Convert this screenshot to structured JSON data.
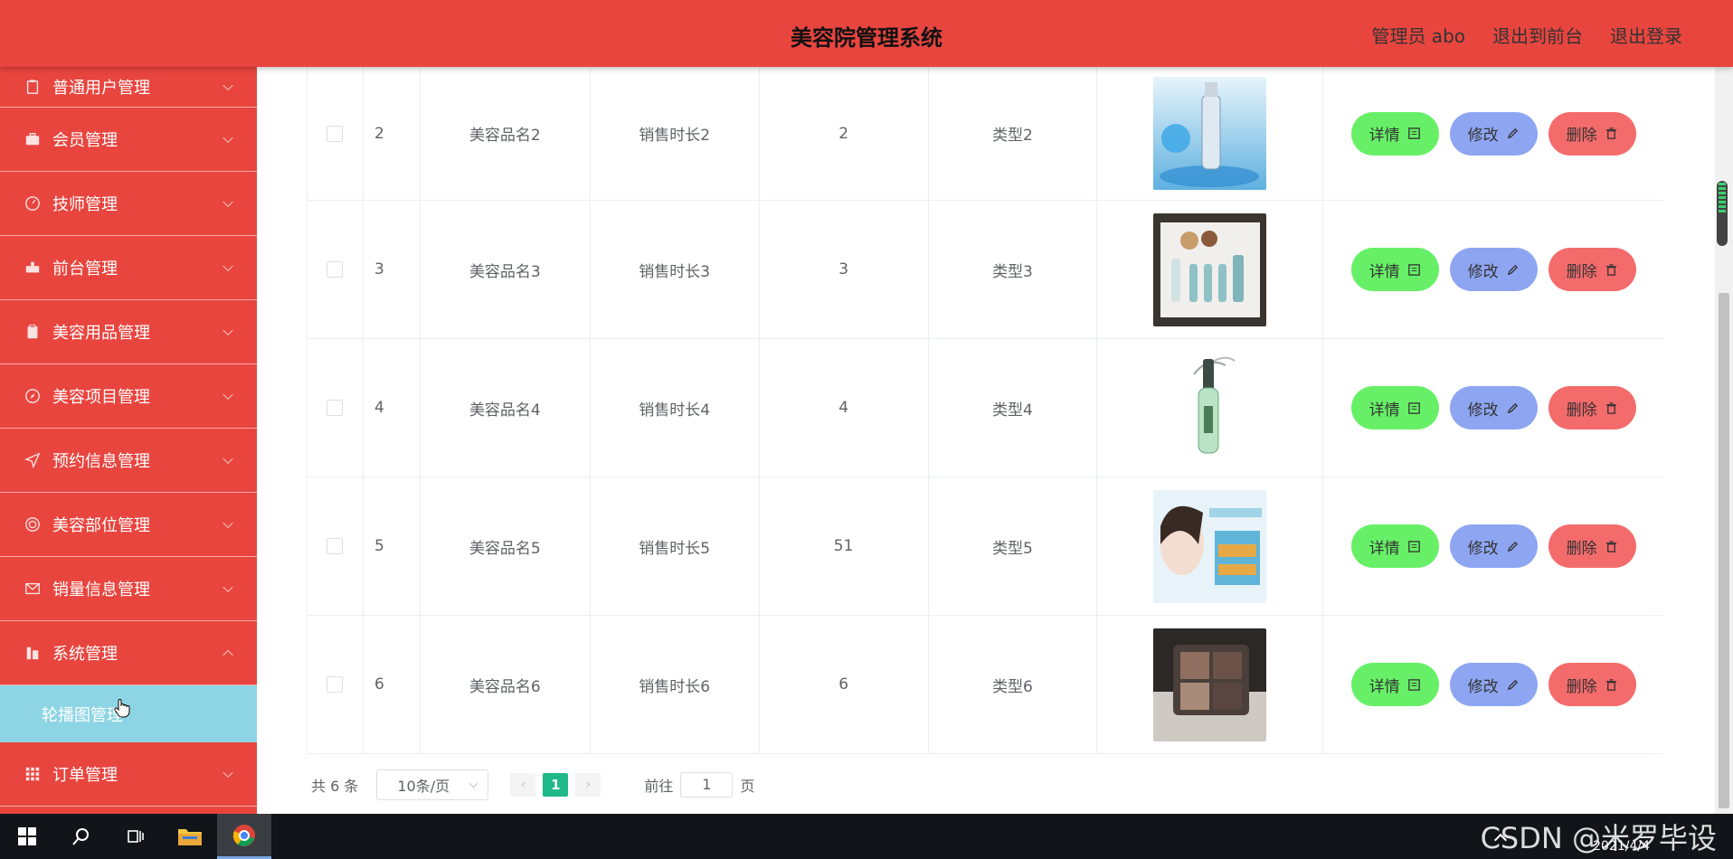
{
  "header": {
    "title": "美容院管理系统",
    "admin_label": "管理员 abo",
    "front_label": "退出到前台",
    "logout_label": "退出登录"
  },
  "sidebar": {
    "items": [
      {
        "label": "普通用户管理",
        "icon": "user-clipboard-icon"
      },
      {
        "label": "会员管理",
        "icon": "briefcase-icon"
      },
      {
        "label": "技师管理",
        "icon": "gauge-icon"
      },
      {
        "label": "前台管理",
        "icon": "desk-icon"
      },
      {
        "label": "美容用品管理",
        "icon": "clipboard-icon"
      },
      {
        "label": "美容项目管理",
        "icon": "compass-icon"
      },
      {
        "label": "预约信息管理",
        "icon": "send-icon"
      },
      {
        "label": "美容部位管理",
        "icon": "target-icon"
      },
      {
        "label": "销量信息管理",
        "icon": "mail-icon"
      },
      {
        "label": "系统管理",
        "icon": "building-icon"
      },
      {
        "label": "订单管理",
        "icon": "grid-icon"
      }
    ],
    "submenu_label": "轮播图管理"
  },
  "table": {
    "rows": [
      {
        "index": "2",
        "name": "美容品名2",
        "duration": "销售时长2",
        "number": "2",
        "type": "类型2",
        "image": "blue-serum-bottle"
      },
      {
        "index": "3",
        "name": "美容品名3",
        "duration": "销售时长3",
        "number": "3",
        "type": "类型3",
        "image": "skincare-gift-set"
      },
      {
        "index": "4",
        "name": "美容品名4",
        "duration": "销售时长4",
        "number": "4",
        "type": "类型4",
        "image": "green-serum-bottle"
      },
      {
        "index": "5",
        "name": "美容品名5",
        "duration": "销售时长5",
        "number": "51",
        "type": "类型5",
        "image": "woman-face-promo"
      },
      {
        "index": "6",
        "name": "美容品名6",
        "duration": "销售时长6",
        "number": "6",
        "type": "类型6",
        "image": "eyeshadow-palette"
      }
    ],
    "actions": {
      "detail": "详情",
      "edit": "修改",
      "delete": "删除"
    }
  },
  "pager": {
    "total": "共 6 条",
    "page_size": "10条/页",
    "current_page": "1",
    "goto_prefix": "前往",
    "goto_value": "1",
    "goto_suffix": "页"
  },
  "taskbar": {
    "watermark": "CSDN @米罗毕设",
    "date": "2021/4/4"
  },
  "colors": {
    "primary_red": "#e8453f",
    "submenu_cyan": "#8dd5e4",
    "btn_green": "#67f067",
    "btn_blue": "#8ea6f2",
    "btn_red": "#f46b6b",
    "page_active": "#1fb889"
  }
}
